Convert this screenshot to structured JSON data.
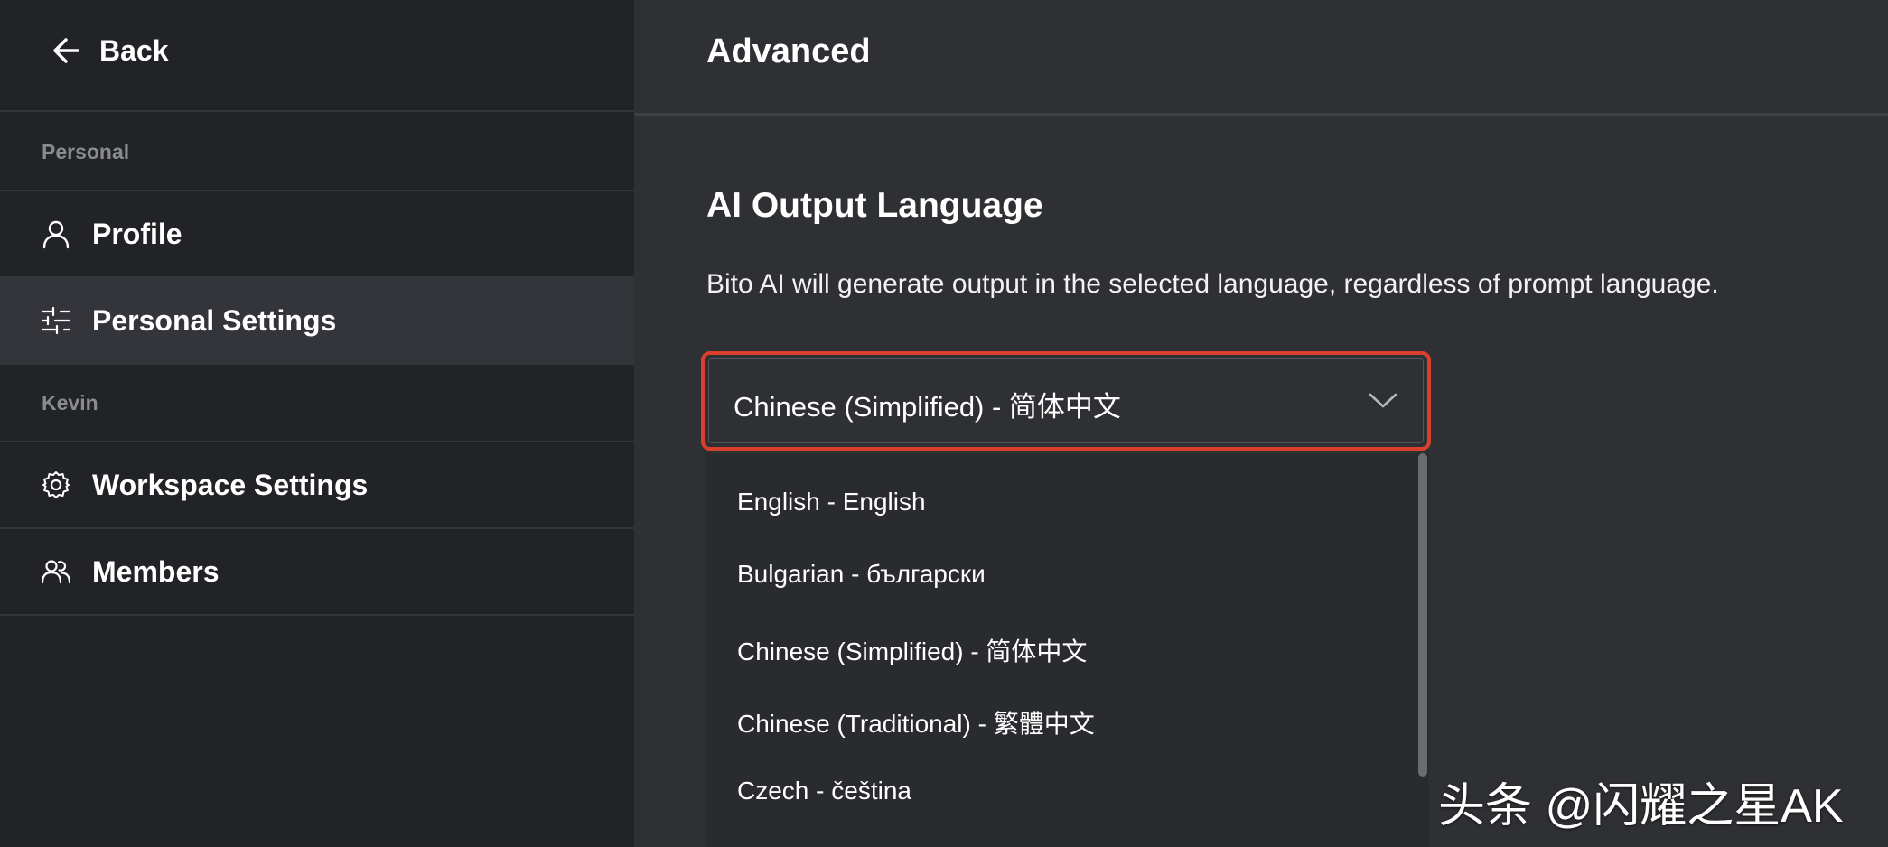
{
  "sidebar": {
    "back_label": "Back",
    "sections": [
      {
        "label": "Personal"
      },
      {
        "label": "Kevin"
      }
    ],
    "items": [
      {
        "label": "Profile",
        "icon": "user-icon"
      },
      {
        "label": "Personal Settings",
        "icon": "sliders-icon",
        "active": true
      },
      {
        "label": "Workspace Settings",
        "icon": "gear-icon"
      },
      {
        "label": "Members",
        "icon": "users-icon"
      }
    ]
  },
  "main": {
    "page_title": "Advanced",
    "section_title": "AI Output Language",
    "description": "Bito AI will generate output in the selected language, regardless of prompt language.",
    "language_select": {
      "selected": "Chinese (Simplified) - 简体中文",
      "options": [
        "English - English",
        "Bulgarian - български",
        "Chinese (Simplified) - 简体中文",
        "Chinese (Traditional) - 繁體中文",
        "Czech - čeština"
      ]
    }
  },
  "watermark": "头条 @闪耀之星AK",
  "colors": {
    "sidebar_bg": "#222326",
    "main_bg": "#2f3033",
    "active_item_bg": "#34353a",
    "highlight_border": "#d9402c",
    "muted_text": "#8a8b8f"
  }
}
